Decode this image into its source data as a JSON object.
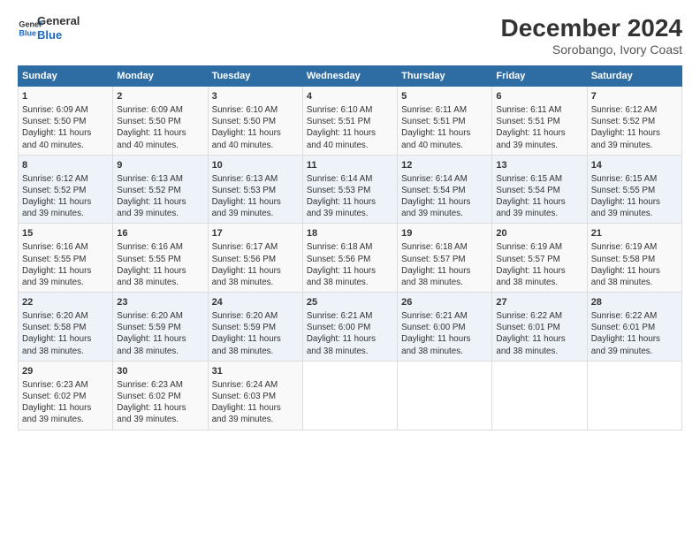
{
  "logo": {
    "line1": "General",
    "line2": "Blue"
  },
  "title": "December 2024",
  "subtitle": "Sorobango, Ivory Coast",
  "days_header": [
    "Sunday",
    "Monday",
    "Tuesday",
    "Wednesday",
    "Thursday",
    "Friday",
    "Saturday"
  ],
  "weeks": [
    [
      {
        "day": "1",
        "sunrise": "6:09 AM",
        "sunset": "5:50 PM",
        "daylight": "11 hours and 40 minutes."
      },
      {
        "day": "2",
        "sunrise": "6:09 AM",
        "sunset": "5:50 PM",
        "daylight": "11 hours and 40 minutes."
      },
      {
        "day": "3",
        "sunrise": "6:10 AM",
        "sunset": "5:50 PM",
        "daylight": "11 hours and 40 minutes."
      },
      {
        "day": "4",
        "sunrise": "6:10 AM",
        "sunset": "5:51 PM",
        "daylight": "11 hours and 40 minutes."
      },
      {
        "day": "5",
        "sunrise": "6:11 AM",
        "sunset": "5:51 PM",
        "daylight": "11 hours and 40 minutes."
      },
      {
        "day": "6",
        "sunrise": "6:11 AM",
        "sunset": "5:51 PM",
        "daylight": "11 hours and 39 minutes."
      },
      {
        "day": "7",
        "sunrise": "6:12 AM",
        "sunset": "5:52 PM",
        "daylight": "11 hours and 39 minutes."
      }
    ],
    [
      {
        "day": "8",
        "sunrise": "6:12 AM",
        "sunset": "5:52 PM",
        "daylight": "11 hours and 39 minutes."
      },
      {
        "day": "9",
        "sunrise": "6:13 AM",
        "sunset": "5:52 PM",
        "daylight": "11 hours and 39 minutes."
      },
      {
        "day": "10",
        "sunrise": "6:13 AM",
        "sunset": "5:53 PM",
        "daylight": "11 hours and 39 minutes."
      },
      {
        "day": "11",
        "sunrise": "6:14 AM",
        "sunset": "5:53 PM",
        "daylight": "11 hours and 39 minutes."
      },
      {
        "day": "12",
        "sunrise": "6:14 AM",
        "sunset": "5:54 PM",
        "daylight": "11 hours and 39 minutes."
      },
      {
        "day": "13",
        "sunrise": "6:15 AM",
        "sunset": "5:54 PM",
        "daylight": "11 hours and 39 minutes."
      },
      {
        "day": "14",
        "sunrise": "6:15 AM",
        "sunset": "5:55 PM",
        "daylight": "11 hours and 39 minutes."
      }
    ],
    [
      {
        "day": "15",
        "sunrise": "6:16 AM",
        "sunset": "5:55 PM",
        "daylight": "11 hours and 39 minutes."
      },
      {
        "day": "16",
        "sunrise": "6:16 AM",
        "sunset": "5:55 PM",
        "daylight": "11 hours and 38 minutes."
      },
      {
        "day": "17",
        "sunrise": "6:17 AM",
        "sunset": "5:56 PM",
        "daylight": "11 hours and 38 minutes."
      },
      {
        "day": "18",
        "sunrise": "6:18 AM",
        "sunset": "5:56 PM",
        "daylight": "11 hours and 38 minutes."
      },
      {
        "day": "19",
        "sunrise": "6:18 AM",
        "sunset": "5:57 PM",
        "daylight": "11 hours and 38 minutes."
      },
      {
        "day": "20",
        "sunrise": "6:19 AM",
        "sunset": "5:57 PM",
        "daylight": "11 hours and 38 minutes."
      },
      {
        "day": "21",
        "sunrise": "6:19 AM",
        "sunset": "5:58 PM",
        "daylight": "11 hours and 38 minutes."
      }
    ],
    [
      {
        "day": "22",
        "sunrise": "6:20 AM",
        "sunset": "5:58 PM",
        "daylight": "11 hours and 38 minutes."
      },
      {
        "day": "23",
        "sunrise": "6:20 AM",
        "sunset": "5:59 PM",
        "daylight": "11 hours and 38 minutes."
      },
      {
        "day": "24",
        "sunrise": "6:20 AM",
        "sunset": "5:59 PM",
        "daylight": "11 hours and 38 minutes."
      },
      {
        "day": "25",
        "sunrise": "6:21 AM",
        "sunset": "6:00 PM",
        "daylight": "11 hours and 38 minutes."
      },
      {
        "day": "26",
        "sunrise": "6:21 AM",
        "sunset": "6:00 PM",
        "daylight": "11 hours and 38 minutes."
      },
      {
        "day": "27",
        "sunrise": "6:22 AM",
        "sunset": "6:01 PM",
        "daylight": "11 hours and 38 minutes."
      },
      {
        "day": "28",
        "sunrise": "6:22 AM",
        "sunset": "6:01 PM",
        "daylight": "11 hours and 39 minutes."
      }
    ],
    [
      {
        "day": "29",
        "sunrise": "6:23 AM",
        "sunset": "6:02 PM",
        "daylight": "11 hours and 39 minutes."
      },
      {
        "day": "30",
        "sunrise": "6:23 AM",
        "sunset": "6:02 PM",
        "daylight": "11 hours and 39 minutes."
      },
      {
        "day": "31",
        "sunrise": "6:24 AM",
        "sunset": "6:03 PM",
        "daylight": "11 hours and 39 minutes."
      },
      null,
      null,
      null,
      null
    ]
  ],
  "labels": {
    "sunrise": "Sunrise:",
    "sunset": "Sunset:",
    "daylight": "Daylight:"
  }
}
